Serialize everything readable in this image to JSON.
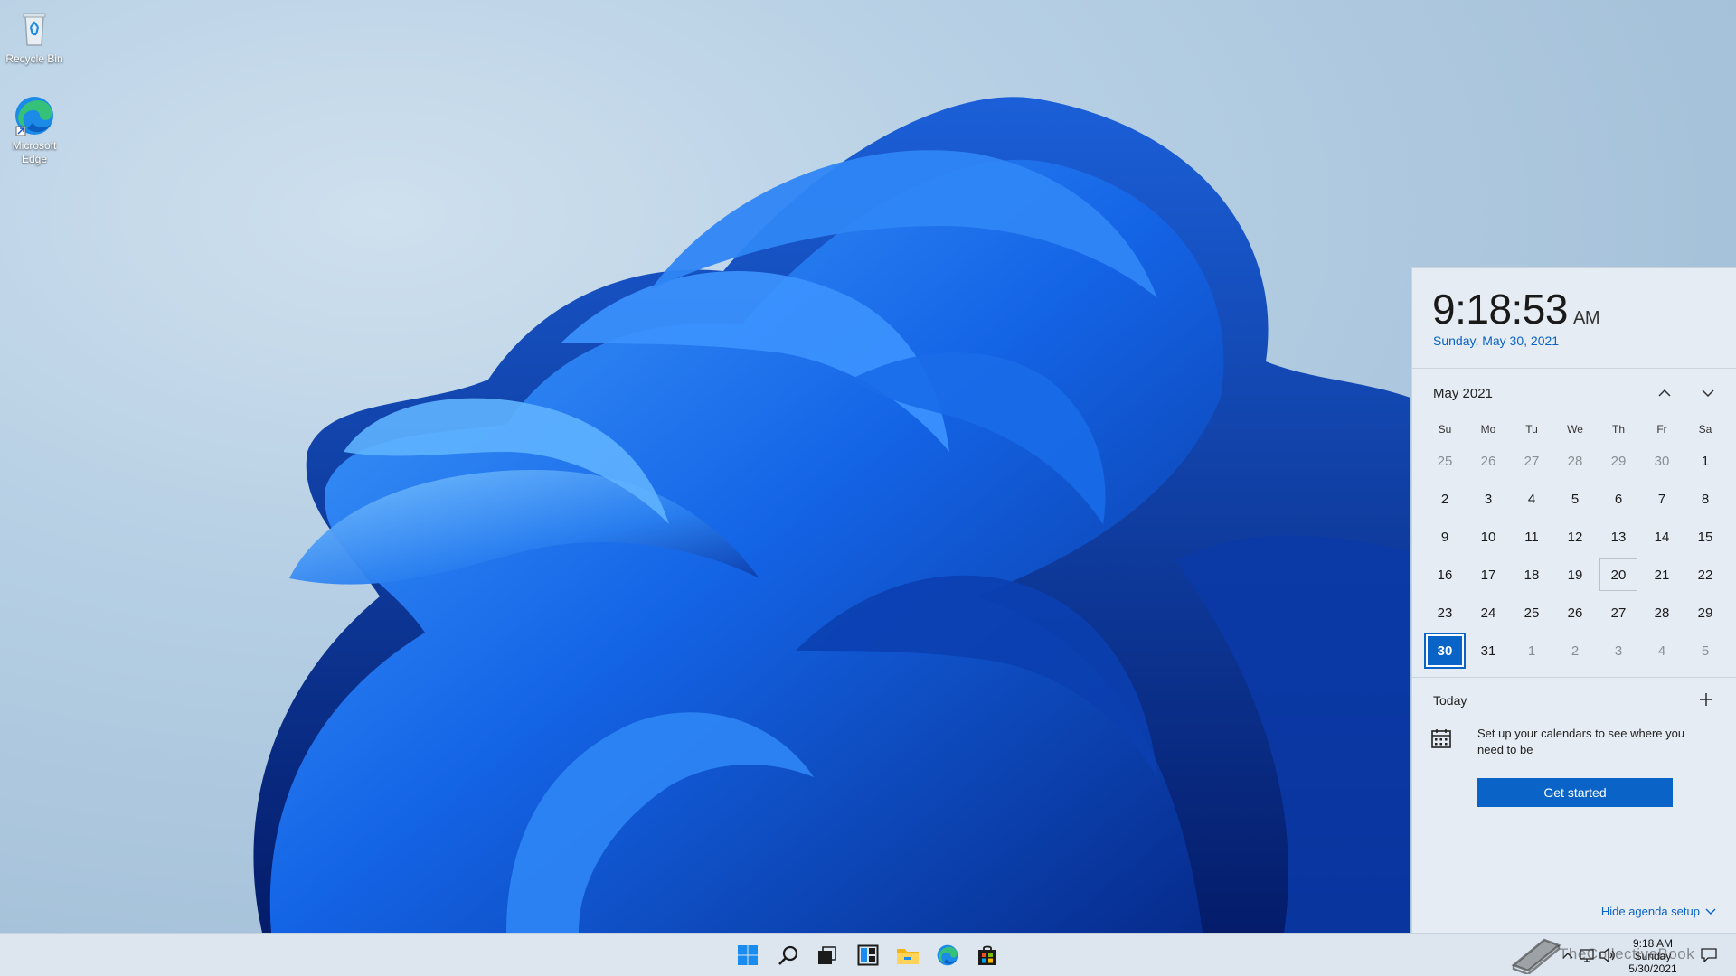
{
  "desktop": {
    "icons": [
      {
        "label": "Recycle Bin",
        "icon": "recycle-bin-icon"
      },
      {
        "label": "Microsoft Edge",
        "icon": "edge-icon"
      }
    ]
  },
  "flyout": {
    "time": "9:18:53",
    "ampm": "AM",
    "date": "Sunday, May 30, 2021",
    "month_label": "May 2021",
    "weekdays": [
      "Su",
      "Mo",
      "Tu",
      "We",
      "Th",
      "Fr",
      "Sa"
    ],
    "weeks": [
      [
        "25",
        "26",
        "27",
        "28",
        "29",
        "30",
        "1"
      ],
      [
        "2",
        "3",
        "4",
        "5",
        "6",
        "7",
        "8"
      ],
      [
        "9",
        "10",
        "11",
        "12",
        "13",
        "14",
        "15"
      ],
      [
        "16",
        "17",
        "18",
        "19",
        "20",
        "21",
        "22"
      ],
      [
        "23",
        "24",
        "25",
        "26",
        "27",
        "28",
        "29"
      ],
      [
        "30",
        "31",
        "1",
        "2",
        "3",
        "4",
        "5"
      ]
    ],
    "today_label": "Today",
    "agenda_text": "Set up your calendars to see where you need to be",
    "get_started_label": "Get started",
    "hide_agenda_label": "Hide agenda setup"
  },
  "taskbar": {
    "apps": [
      "start-icon",
      "search-icon",
      "task-view-icon",
      "widgets-icon",
      "file-explorer-icon",
      "edge-icon",
      "store-icon"
    ],
    "clock_time": "9:18 AM",
    "clock_day": "Sunday",
    "clock_date": "5/30/2021"
  },
  "watermark": {
    "text": "TheCollectiveBook"
  },
  "colors": {
    "accent": "#0a64c8",
    "date_blue": "#0a62c4"
  }
}
